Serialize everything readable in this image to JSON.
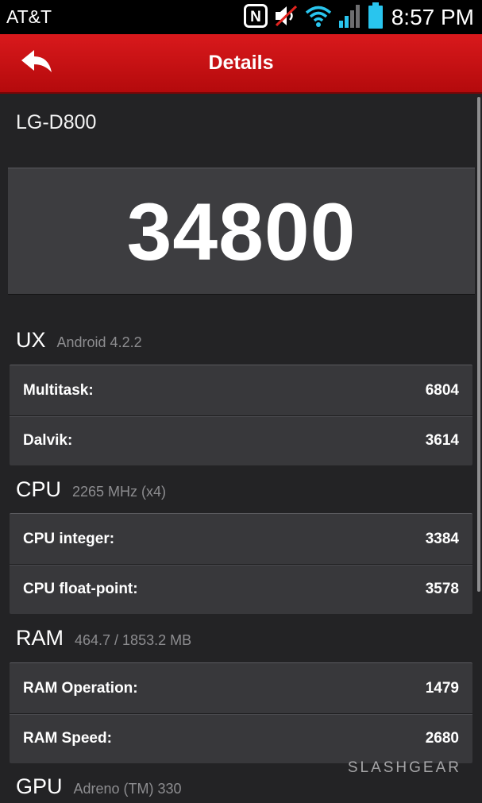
{
  "status_bar": {
    "carrier": "AT&T",
    "time": "8:57 PM",
    "icons": [
      "nfc-icon",
      "mute-icon",
      "wifi-icon",
      "signal-icon",
      "battery-icon"
    ],
    "nfc_letter": "N"
  },
  "header": {
    "title": "Details",
    "back_icon": "back-arrow-icon"
  },
  "device": {
    "name": "LG-D800"
  },
  "score": {
    "total": "34800"
  },
  "sections": [
    {
      "name": "UX",
      "info": "Android 4.2.2",
      "metrics": [
        {
          "label": "Multitask:",
          "value": "6804"
        },
        {
          "label": "Dalvik:",
          "value": "3614"
        }
      ]
    },
    {
      "name": "CPU",
      "info": "2265 MHz (x4)",
      "metrics": [
        {
          "label": "CPU integer:",
          "value": "3384"
        },
        {
          "label": "CPU float-point:",
          "value": "3578"
        }
      ]
    },
    {
      "name": "RAM",
      "info": "464.7 / 1853.2 MB",
      "metrics": [
        {
          "label": "RAM Operation:",
          "value": "1479"
        },
        {
          "label": "RAM Speed:",
          "value": "2680"
        }
      ]
    },
    {
      "name": "GPU",
      "info": "Adreno (TM) 330",
      "metrics": []
    }
  ],
  "watermark": "SLASHGEAR",
  "colors": {
    "header_red": "#d9191c",
    "background": "#232325",
    "panel": "#38383b",
    "battery": "#29c5ee",
    "wifi": "#29c5ee"
  }
}
